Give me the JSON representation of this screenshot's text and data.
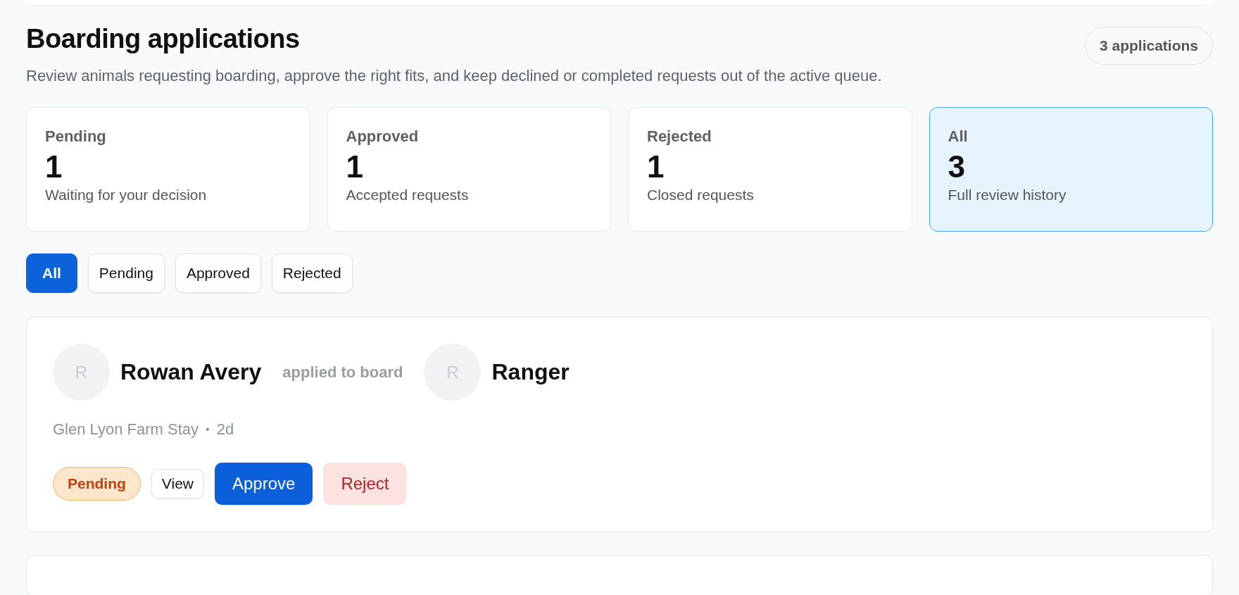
{
  "header": {
    "title": "Boarding applications",
    "count_badge": "3 applications",
    "description": "Review animals requesting boarding, approve the right fits, and keep declined or completed requests out of the active queue."
  },
  "stats": [
    {
      "label": "Pending",
      "value": "1",
      "caption": "Waiting for your decision",
      "selected": false
    },
    {
      "label": "Approved",
      "value": "1",
      "caption": "Accepted requests",
      "selected": false
    },
    {
      "label": "Rejected",
      "value": "1",
      "caption": "Closed requests",
      "selected": false
    },
    {
      "label": "All",
      "value": "3",
      "caption": "Full review history",
      "selected": true
    }
  ],
  "filters": [
    {
      "label": "All",
      "selected": true
    },
    {
      "label": "Pending",
      "selected": false
    },
    {
      "label": "Approved",
      "selected": false
    },
    {
      "label": "Rejected",
      "selected": false
    }
  ],
  "applications": [
    {
      "applicant_initial": "R",
      "applicant": "Rowan Avery",
      "connector": "applied to board",
      "animal_initial": "R",
      "animal": "Ranger",
      "location": "Glen Lyon Farm Stay",
      "separator": "•",
      "age": "2d",
      "status": {
        "kind": "pending",
        "label": "Pending"
      },
      "actions": [
        {
          "kind": "view",
          "label": "View"
        },
        {
          "kind": "approve",
          "label": "Approve"
        },
        {
          "kind": "reject",
          "label": "Reject"
        }
      ]
    }
  ]
}
